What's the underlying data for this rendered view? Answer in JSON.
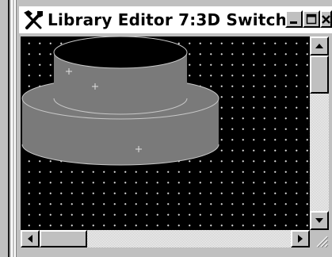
{
  "window": {
    "title": "Library Editor 7:3D Switch",
    "app_icon": "tools-icon"
  },
  "caption_buttons": [
    {
      "name": "minimize-button",
      "icon": "minimize-icon"
    },
    {
      "name": "maximize-button",
      "icon": "maximize-icon"
    },
    {
      "name": "close-button",
      "icon": "close-icon"
    }
  ],
  "canvas": {
    "background_color": "#000000",
    "grid_dot_color": "#d8d8d8",
    "shape_fill_color": "#7a7a7a",
    "shape_outline_color": "#c8c8c8",
    "shapes": [
      "upper-cylinder",
      "lower-cylinder"
    ],
    "markers": [
      "anchor-marker",
      "anchor-marker",
      "anchor-marker"
    ]
  },
  "scrollbars": {
    "vertical": {
      "up_icon": "arrow-up-icon",
      "down_icon": "arrow-down-icon"
    },
    "horizontal": {
      "left_icon": "arrow-left-icon",
      "right_icon": "arrow-right-icon"
    },
    "resize_icon": "resize-grip-icon"
  }
}
